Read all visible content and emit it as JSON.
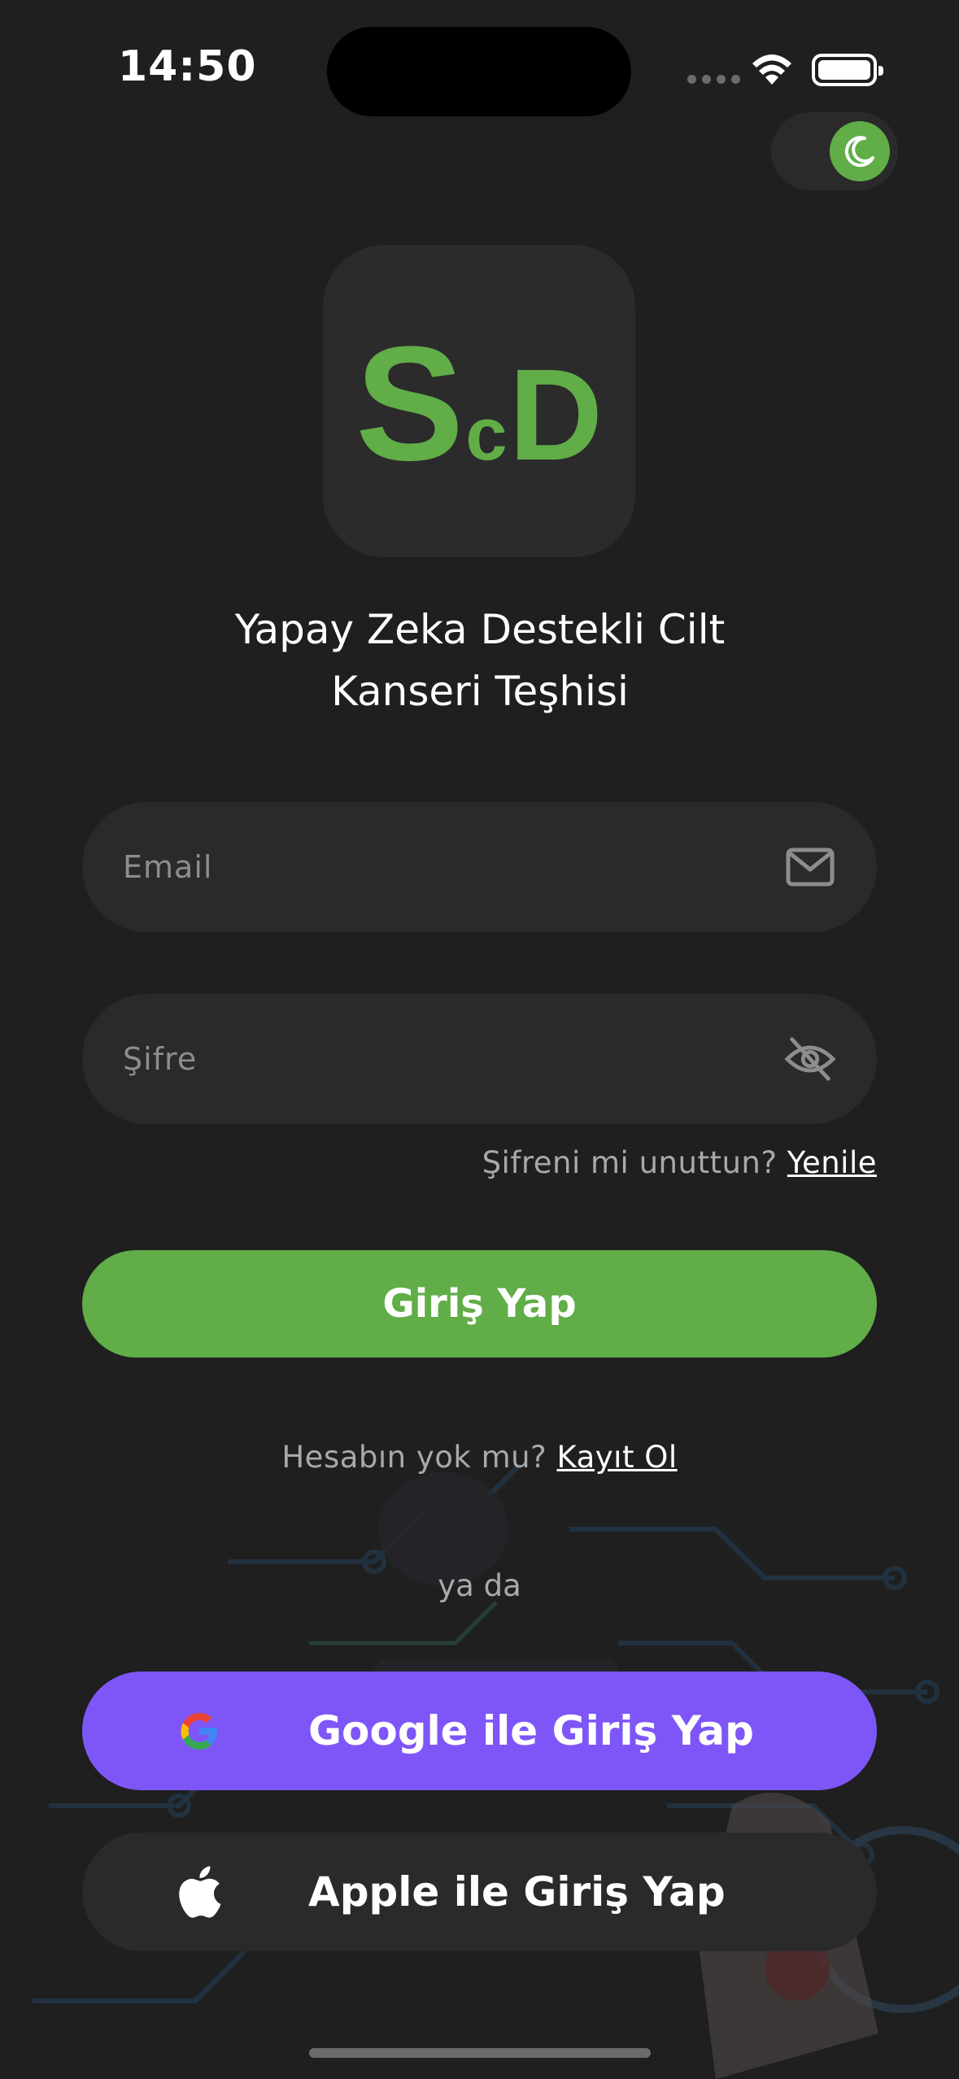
{
  "status_bar": {
    "time": "14:50"
  },
  "theme_toggle": {
    "mode": "dark",
    "icon": "moon-icon"
  },
  "logo": {
    "s": "S",
    "c": "c",
    "d": "D"
  },
  "app_title": "Yapay Zeka Destekli Cilt\nKanseri Teşhisi",
  "form": {
    "email_placeholder": "Email",
    "email_value": "",
    "password_placeholder": "Şifre",
    "password_value": "",
    "forgot_prompt": "Şifreni mi unuttun? ",
    "forgot_link": "Yenile",
    "login_label": "Giriş Yap"
  },
  "signup": {
    "prompt": "Hesabın yok mu? ",
    "link": "Kayıt Ol"
  },
  "divider_text": "ya da",
  "social": {
    "google_label": "Google ile Giriş Yap",
    "apple_label": "Apple ile Giriş Yap"
  },
  "colors": {
    "background": "#1f1f1f",
    "surface": "#2a2a2a",
    "accent_green": "#61ad48",
    "google_purple": "#7e56f8",
    "muted_text": "#a9a9a9",
    "placeholder": "#8d8d8d"
  }
}
